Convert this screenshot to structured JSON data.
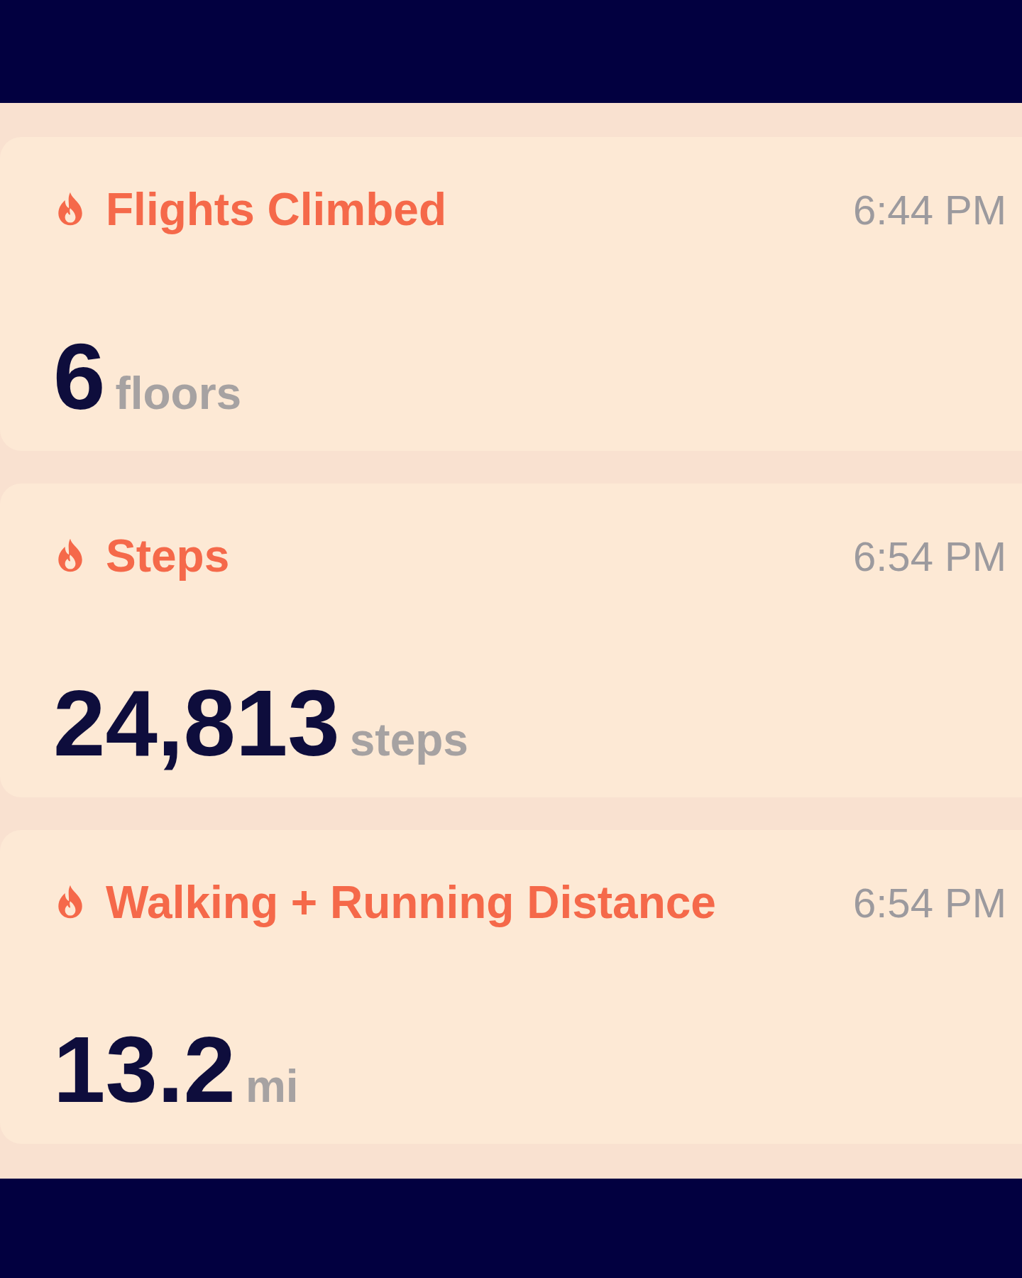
{
  "cards": [
    {
      "title": "Flights Climbed",
      "time": "6:44 PM",
      "value": "6",
      "unit": "floors"
    },
    {
      "title": "Steps",
      "time": "6:54 PM",
      "value": "24,813",
      "unit": "steps"
    },
    {
      "title": "Walking + Running Distance",
      "time": "6:54 PM",
      "value": "13.2",
      "unit": "mi"
    }
  ]
}
